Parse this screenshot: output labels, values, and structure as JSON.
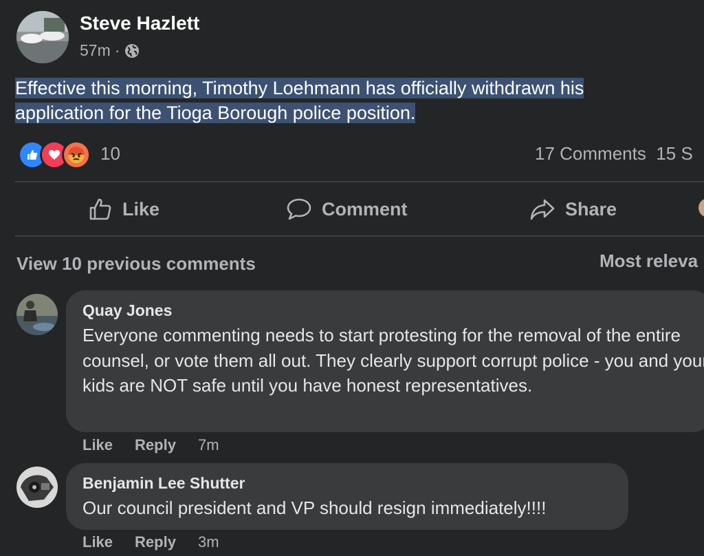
{
  "post": {
    "author": "Steve Hazlett",
    "time": "57m",
    "separator": "·",
    "text": "Effective this morning, Timothy Loehmann has officially withdrawn  his application for the Tioga Borough police position.",
    "reaction_count": "10",
    "comments_count": "17 Comments",
    "shares_count": "15 S"
  },
  "actions": {
    "like": "Like",
    "comment": "Comment",
    "share": "Share"
  },
  "comments_section": {
    "view_previous": "View 10 previous comments",
    "sort": "Most releva"
  },
  "comments": [
    {
      "author": "Quay Jones",
      "text": "Everyone commenting needs to start protesting for the removal of the entire counsel, or vote them all out. They clearly support corrupt police - you and your kids are NOT safe until you have honest representatives.",
      "like": "Like",
      "reply": "Reply",
      "time": "7m"
    },
    {
      "author": "Benjamin Lee Shutter",
      "text": "Our council president and VP should resign immediately!!!!",
      "like": "Like",
      "reply": "Reply",
      "time": "3m"
    }
  ],
  "icons": {
    "audience": "globe-icon",
    "reactions": [
      "like-reaction-icon",
      "love-reaction-icon",
      "angry-reaction-icon"
    ],
    "like": "thumbs-up-icon",
    "comment": "speech-bubble-icon",
    "share": "share-arrow-icon"
  },
  "colors": {
    "background": "#242526",
    "bubble": "#3a3b3c",
    "selection_highlight": "#3d5273",
    "like_blue": "#2d88ff",
    "love_red": "#f33e58",
    "angry_orange": "#f7714c"
  }
}
